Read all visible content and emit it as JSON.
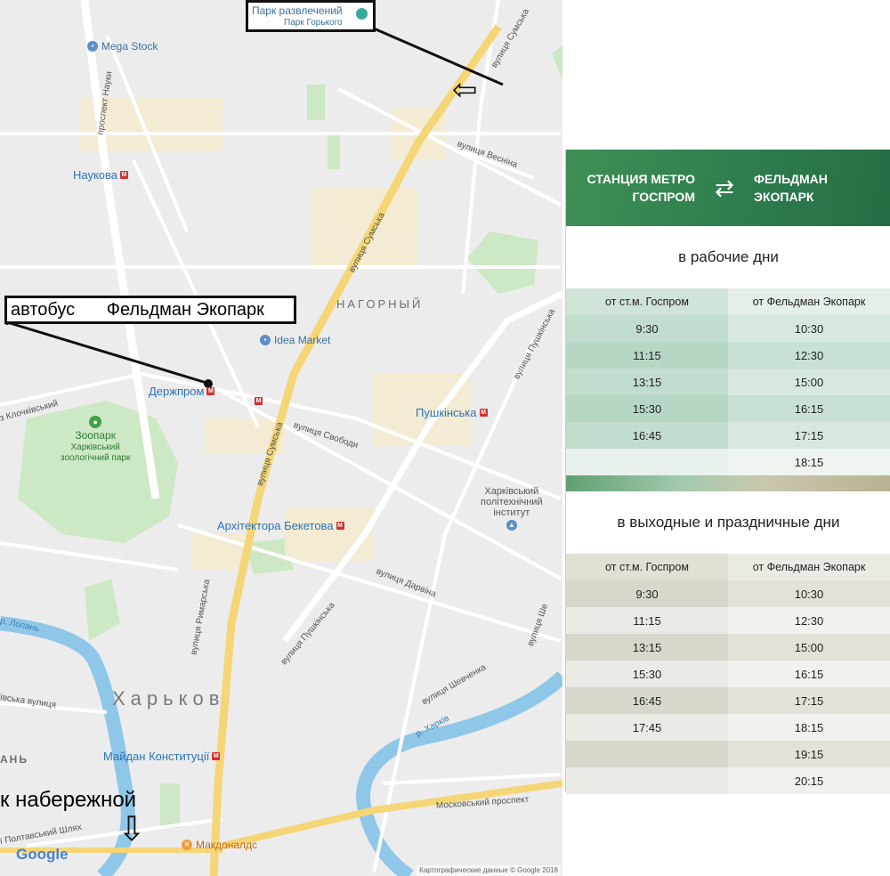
{
  "map": {
    "pois": {
      "park_name": "Парк развлечений",
      "park_sub": "Парк Горького",
      "mega_stock": "Mega Stock",
      "idea_market": "Idea Market",
      "zoo_name": "Зоопарк",
      "zoo_sub1": "Харківський",
      "zoo_sub2": "зоологічний парк",
      "polytech1": "Харківський",
      "polytech2": "політехнічний",
      "polytech3": "інститут",
      "mcdonalds": "Макдоналдс"
    },
    "stations": {
      "naukova": "Наукова",
      "derzhprom": "Держпром",
      "pushkinska": "Пушкінська",
      "beketova": "Архітектора Бекетова",
      "maidan": "Майдан Конституції",
      "metro_glyph": "M"
    },
    "streets": {
      "sumska_top": "вулиця Сумська",
      "sumska_mid": "вулиця Сумська",
      "sumska_low": "вулиця Сумська",
      "vesnina": "вулиця Весніна",
      "nauky": "проспект Науки",
      "svobody": "вулиця Свободи",
      "klochkivsky": "з Клочківський",
      "darvina": "вулиця Дарвіна",
      "rymarska": "вулиця Римарська",
      "pushkinska_st": "вулиця Пушкінська",
      "pushkinska_ne": "вулиця Пушкінська",
      "shevchenka": "вулиця Шевченка",
      "kharkiv_river": "р. Харків",
      "lopan_river": "р. Лопань",
      "moskovsky": "Московський проспект",
      "poltavsky": "ї Полтавський Шлях",
      "side_vulytsia": "ївська вулиця",
      "right_edge": "вулиця Ше"
    },
    "districts": {
      "nagorny": "НАГОРНЫЙ",
      "city": "Харьков",
      "left_edge": "АНЬ"
    },
    "google": "Google",
    "footer": "Картографические данные © Google 2018"
  },
  "annotations": {
    "park_box_title": "Парк развлечений",
    "park_box_sub": "Парк Горького",
    "bus_label": "автобус",
    "bus_dest": "Фельдман Экопарк",
    "embankment": "к набережной",
    "down_arrow": "⇩",
    "left_arrow": "⇦"
  },
  "schedule": {
    "from": "СТАНЦИЯ МЕТРО\nГОСПРОМ",
    "to": "ФЕЛЬДМАН\nЭКОПАРК",
    "arrow": "⇄",
    "weekdays_title": "в рабочие дни",
    "weekends_title": "в выходные и праздничные дни",
    "col_from": "от ст.м. Госпром",
    "col_to": "от Фельдман Экопарк",
    "weekdays": [
      [
        "9:30",
        "10:30"
      ],
      [
        "11:15",
        "12:30"
      ],
      [
        "13:15",
        "15:00"
      ],
      [
        "15:30",
        "16:15"
      ],
      [
        "16:45",
        "17:15"
      ],
      [
        "",
        "18:15"
      ]
    ],
    "weekends": [
      [
        "9:30",
        "10:30"
      ],
      [
        "11:15",
        "12:30"
      ],
      [
        "13:15",
        "15:00"
      ],
      [
        "15:30",
        "16:15"
      ],
      [
        "16:45",
        "17:15"
      ],
      [
        "17:45",
        "18:15"
      ],
      [
        "",
        "19:15"
      ],
      [
        "",
        "20:15"
      ]
    ]
  }
}
